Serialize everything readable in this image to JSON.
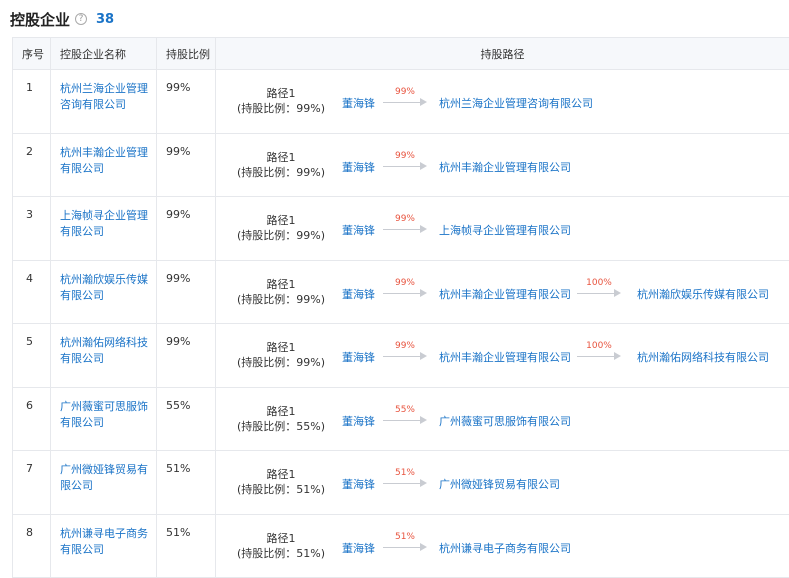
{
  "section": {
    "title": "控股企业",
    "count": "38"
  },
  "table": {
    "headers": {
      "index": "序号",
      "name": "控股企业名称",
      "ratio": "持股比例",
      "path": "持股路径"
    },
    "rows": [
      {
        "index": "1",
        "name_l1": "杭州兰海企业管理",
        "name_l2": "咨询有限公司",
        "ratio": "99%",
        "path_title": "路径1",
        "path_sub": "(持股比例：99%)",
        "holder": "董海锋",
        "pct1": "99%",
        "node1": "杭州兰海企业管理咨询有限公司",
        "pct2": "",
        "node2": ""
      },
      {
        "index": "2",
        "name_l1": "杭州丰瀚企业管理",
        "name_l2": "有限公司",
        "ratio": "99%",
        "path_title": "路径1",
        "path_sub": "(持股比例：99%)",
        "holder": "董海锋",
        "pct1": "99%",
        "node1": "杭州丰瀚企业管理有限公司",
        "pct2": "",
        "node2": ""
      },
      {
        "index": "3",
        "name_l1": "上海帧寻企业管理",
        "name_l2": "有限公司",
        "ratio": "99%",
        "path_title": "路径1",
        "path_sub": "(持股比例：99%)",
        "holder": "董海锋",
        "pct1": "99%",
        "node1": "上海帧寻企业管理有限公司",
        "pct2": "",
        "node2": ""
      },
      {
        "index": "4",
        "name_l1": "杭州瀚欣娱乐传媒",
        "name_l2": "有限公司",
        "ratio": "99%",
        "path_title": "路径1",
        "path_sub": "(持股比例：99%)",
        "holder": "董海锋",
        "pct1": "99%",
        "node1": "杭州丰瀚企业管理有限公司",
        "pct2": "100%",
        "node2": "杭州瀚欣娱乐传媒有限公司"
      },
      {
        "index": "5",
        "name_l1": "杭州瀚佑网络科技",
        "name_l2": "有限公司",
        "ratio": "99%",
        "path_title": "路径1",
        "path_sub": "(持股比例：99%)",
        "holder": "董海锋",
        "pct1": "99%",
        "node1": "杭州丰瀚企业管理有限公司",
        "pct2": "100%",
        "node2": "杭州瀚佑网络科技有限公司"
      },
      {
        "index": "6",
        "name_l1": "广州薇蜜可思服饰",
        "name_l2": "有限公司",
        "ratio": "55%",
        "path_title": "路径1",
        "path_sub": "(持股比例：55%)",
        "holder": "董海锋",
        "pct1": "55%",
        "node1": "广州薇蜜可思服饰有限公司",
        "pct2": "",
        "node2": ""
      },
      {
        "index": "7",
        "name_l1": "广州微娅锋贸易有",
        "name_l2": "限公司",
        "ratio": "51%",
        "path_title": "路径1",
        "path_sub": "(持股比例：51%)",
        "holder": "董海锋",
        "pct1": "51%",
        "node1": "广州微娅锋贸易有限公司",
        "pct2": "",
        "node2": ""
      },
      {
        "index": "8",
        "name_l1": "杭州谦寻电子商务",
        "name_l2": "有限公司",
        "ratio": "51%",
        "path_title": "路径1",
        "path_sub": "(持股比例：51%)",
        "holder": "董海锋",
        "pct1": "51%",
        "node1": "杭州谦寻电子商务有限公司",
        "pct2": "",
        "node2": ""
      }
    ]
  },
  "colors": {
    "link": "#1a73c7",
    "percent": "#e8543f",
    "header_bg": "#f6f8fb",
    "border": "#e6e8ec"
  }
}
